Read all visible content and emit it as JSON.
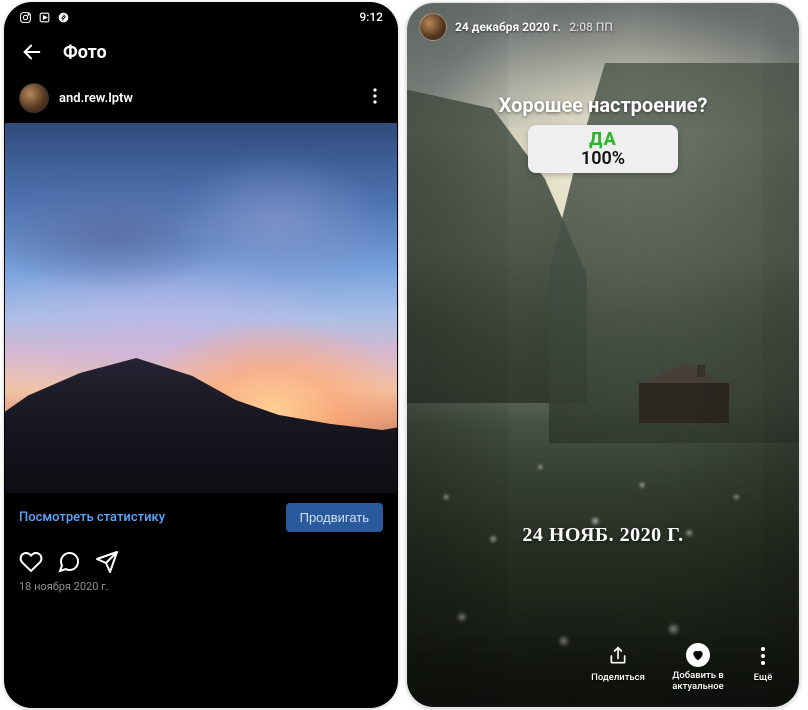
{
  "left": {
    "statusbar": {
      "time": "9:12"
    },
    "header": {
      "title": "Фото"
    },
    "post": {
      "username": "and.rew.lptw",
      "stats_link": "Посмотреть статистику",
      "promote": "Продвигать",
      "date": "18 ноября 2020 г."
    }
  },
  "right": {
    "header": {
      "date": "24 декабря 2020 г.",
      "time": "2:08 ПП"
    },
    "poll": {
      "question": "Хорошее настроение?",
      "yes": "ДА",
      "pct": "100%"
    },
    "caption": "24 НОЯБ. 2020 Г.",
    "footer": {
      "share": "Поделиться",
      "highlight": "Добавить в актуальное",
      "more": "Ещё"
    }
  }
}
